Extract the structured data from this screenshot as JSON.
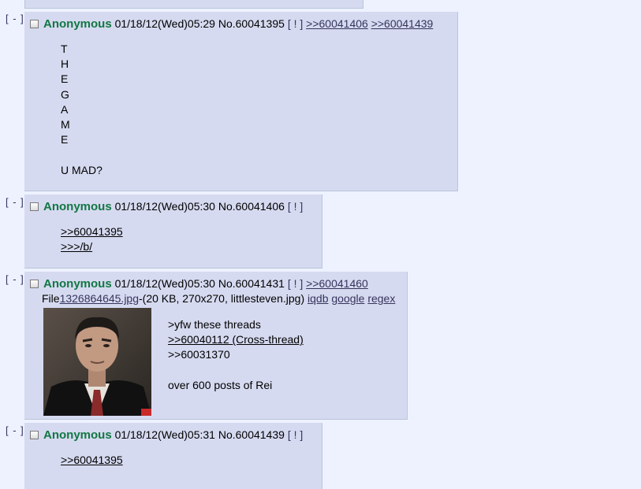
{
  "toggle_label": "[ - ]",
  "report_label": "[ ! ]",
  "posts": [
    {
      "name": "Anonymous",
      "date": "01/18/12(Wed)05:29",
      "no": "No.60041395",
      "replies": [
        ">>60041406",
        ">>60041439"
      ],
      "lines": [
        "T",
        "H",
        "E",
        "G",
        "A",
        "M",
        "E",
        "",
        "U MAD?"
      ]
    },
    {
      "name": "Anonymous",
      "date": "01/18/12(Wed)05:30",
      "no": "No.60041406",
      "replies": [],
      "lines": [
        ">>60041395",
        ">>>/b/"
      ]
    },
    {
      "name": "Anonymous",
      "date": "01/18/12(Wed)05:30",
      "no": "No.60041431",
      "replies": [
        ">>60041460"
      ],
      "file": {
        "prefix": "File",
        "filename": "1326864645.jpg",
        "meta": "-(20 KB, 270x270, littlesteven.jpg)",
        "search_links": [
          "iqdb",
          "google",
          "regex"
        ]
      },
      "lines": [
        ">yfw these threads",
        ">>60040112 (Cross-thread)",
        ">>60031370",
        "",
        "over 600 posts of Rei"
      ]
    },
    {
      "name": "Anonymous",
      "date": "01/18/12(Wed)05:31",
      "no": "No.60041439",
      "replies": [],
      "lines": [
        ">>60041395"
      ]
    }
  ]
}
